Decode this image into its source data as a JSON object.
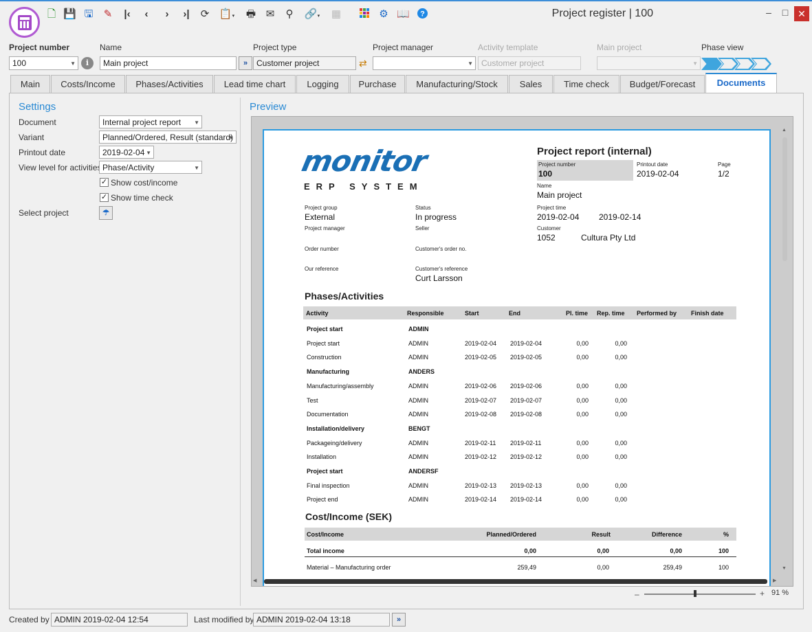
{
  "window": {
    "title": "Project register | 100",
    "controls": [
      "–",
      "□",
      "✕"
    ]
  },
  "toolbar": {
    "icons": [
      "new-icon",
      "save-icon",
      "save-close-icon",
      "delete-icon",
      "first-icon",
      "prev-icon",
      "next-icon",
      "last-icon",
      "refresh-icon",
      "clipboard-icon",
      "print-icon",
      "mail-icon",
      "search-icon",
      "link-icon",
      "grid-icon",
      "apps-icon",
      "settings-icon",
      "book-icon",
      "help-icon"
    ]
  },
  "header": {
    "project_number_label": "Project number",
    "project_number_value": "100",
    "name_label": "Name",
    "name_value": "Main project",
    "project_type_label": "Project type",
    "project_type_value": "Customer project",
    "project_manager_label": "Project manager",
    "project_manager_value": "",
    "activity_template_label": "Activity template",
    "activity_template_value": "Customer project",
    "main_project_label": "Main project",
    "main_project_value": "",
    "phase_view_label": "Phase view"
  },
  "tabs": [
    "Main",
    "Costs/Income",
    "Phases/Activities",
    "Lead time chart",
    "Logging",
    "Purchase",
    "Manufacturing/Stock",
    "Sales",
    "Time check",
    "Budget/Forecast",
    "Documents"
  ],
  "settings": {
    "title": "Settings",
    "document_label": "Document",
    "document_value": "Internal project report",
    "variant_label": "Variant",
    "variant_value": "Planned/Ordered, Result (standard)",
    "printout_date_label": "Printout date",
    "printout_date_value": "2019-02-04",
    "view_level_label": "View level for activities",
    "view_level_value": "Phase/Activity",
    "show_cost_label": "Show cost/income",
    "show_cost_checked": true,
    "show_time_label": "Show time check",
    "show_time_checked": true,
    "select_project_label": "Select project"
  },
  "preview": {
    "title": "Preview",
    "zoom": "91 %",
    "logo_word": "monitor",
    "logo_sub": "ERP SYSTEM",
    "report_title": "Project report (internal)",
    "project_number_label": "Project number",
    "project_number": "100",
    "printout_date_label": "Printout date",
    "printout_date": "2019-02-04",
    "page_label": "Page",
    "page": "1/2",
    "name_label": "Name",
    "name": "Main project",
    "project_group_label": "Project group",
    "project_group": "External",
    "status_label": "Status",
    "status": "In progress",
    "project_time_label": "Project time",
    "project_time_start": "2019-02-04",
    "project_time_end": "2019-02-14",
    "project_manager_label": "Project manager",
    "seller_label": "Seller",
    "customer_label": "Customer",
    "customer_code": "1052",
    "customer_name": "Cultura Pty Ltd",
    "order_number_label": "Order number",
    "customers_order_label": "Customer's order no.",
    "our_reference_label": "Our reference",
    "customers_reference_label": "Customer's reference",
    "customers_reference": "Curt Larsson",
    "phases_title": "Phases/Activities",
    "phases_headers": [
      "Activity",
      "Responsible",
      "Start",
      "End",
      "Pl. time",
      "Rep. time",
      "Performed by",
      "Finish date"
    ],
    "phase_rows": [
      {
        "activity": "Project start",
        "responsible": "ADMIN",
        "start": "",
        "end": "",
        "pl": "",
        "rep": "",
        "bold": true
      },
      {
        "activity": "Project start",
        "responsible": "ADMIN",
        "start": "2019-02-04",
        "end": "2019-02-04",
        "pl": "0,00",
        "rep": "0,00",
        "bold": false
      },
      {
        "activity": "Construction",
        "responsible": "ADMIN",
        "start": "2019-02-05",
        "end": "2019-02-05",
        "pl": "0,00",
        "rep": "0,00",
        "bold": false
      },
      {
        "activity": "Manufacturing",
        "responsible": "ANDERS",
        "start": "",
        "end": "",
        "pl": "",
        "rep": "",
        "bold": true
      },
      {
        "activity": "Manufacturing/assembly",
        "responsible": "ADMIN",
        "start": "2019-02-06",
        "end": "2019-02-06",
        "pl": "0,00",
        "rep": "0,00",
        "bold": false
      },
      {
        "activity": "Test",
        "responsible": "ADMIN",
        "start": "2019-02-07",
        "end": "2019-02-07",
        "pl": "0,00",
        "rep": "0,00",
        "bold": false
      },
      {
        "activity": "Documentation",
        "responsible": "ADMIN",
        "start": "2019-02-08",
        "end": "2019-02-08",
        "pl": "0,00",
        "rep": "0,00",
        "bold": false
      },
      {
        "activity": "Installation/delivery",
        "responsible": "BENGT",
        "start": "",
        "end": "",
        "pl": "",
        "rep": "",
        "bold": true
      },
      {
        "activity": "Packageing/delivery",
        "responsible": "ADMIN",
        "start": "2019-02-11",
        "end": "2019-02-11",
        "pl": "0,00",
        "rep": "0,00",
        "bold": false
      },
      {
        "activity": "Installation",
        "responsible": "ADMIN",
        "start": "2019-02-12",
        "end": "2019-02-12",
        "pl": "0,00",
        "rep": "0,00",
        "bold": false
      },
      {
        "activity": "Project start",
        "responsible": "ANDERSF",
        "start": "",
        "end": "",
        "pl": "",
        "rep": "",
        "bold": true
      },
      {
        "activity": "Final inspection",
        "responsible": "ADMIN",
        "start": "2019-02-13",
        "end": "2019-02-13",
        "pl": "0,00",
        "rep": "0,00",
        "bold": false
      },
      {
        "activity": "Project end",
        "responsible": "ADMIN",
        "start": "2019-02-14",
        "end": "2019-02-14",
        "pl": "0,00",
        "rep": "0,00",
        "bold": false
      }
    ],
    "cost_title": "Cost/Income (SEK)",
    "cost_headers": [
      "Cost/Income",
      "Planned/Ordered",
      "Result",
      "Difference",
      "%"
    ],
    "cost_rows": [
      {
        "label": "Total income",
        "planned": "0,00",
        "result": "0,00",
        "diff": "0,00",
        "pct": "100",
        "bold": true
      },
      {
        "label": "Material – Manufacturing order",
        "planned": "259,49",
        "result": "0,00",
        "diff": "259,49",
        "pct": "100",
        "bold": false
      }
    ]
  },
  "footer": {
    "created_by_label": "Created by",
    "created_by_value": "ADMIN 2019-02-04 12:54",
    "last_modified_label": "Last modified by",
    "last_modified_value": "ADMIN 2019-02-04 13:18"
  },
  "colors": {
    "accent": "#2a8ad4",
    "app_icon": "#a348c8",
    "logo": "#1a6fb5"
  }
}
